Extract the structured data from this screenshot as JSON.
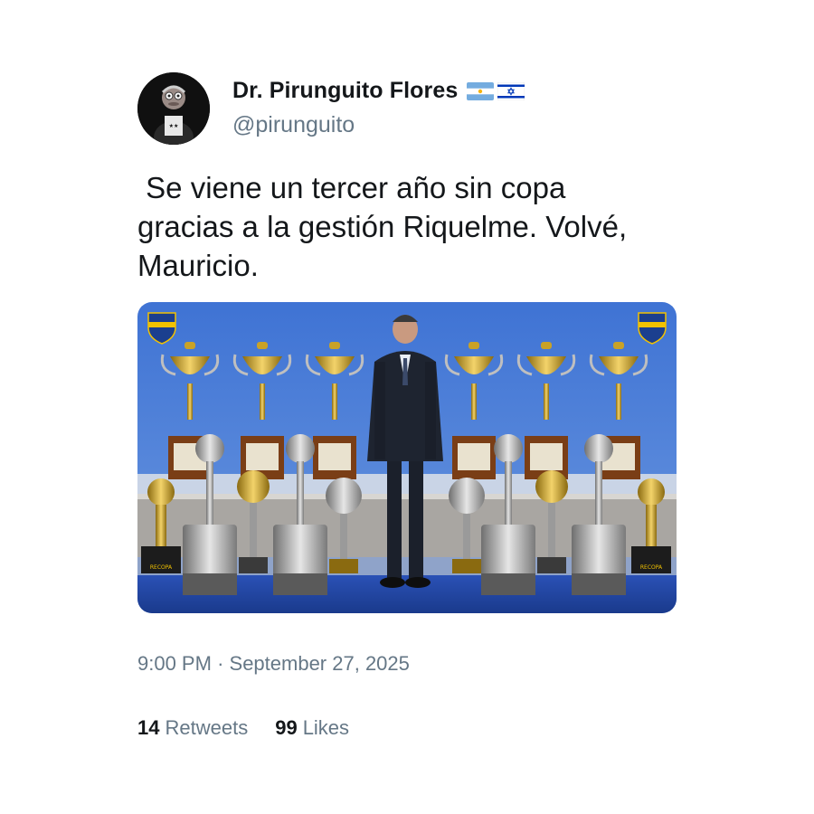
{
  "user": {
    "display_name": "Dr. Pirunguito Flores",
    "handle": "@pirunguito",
    "flags": [
      "argentina-flag-icon",
      "israel-flag-icon"
    ]
  },
  "tweet": {
    "text": " Se viene un tercer año sin copa\ngracias a la gestión Riquelme. Volvé,\nMauricio.",
    "time": "9:00 PM",
    "separator": "·",
    "date": "September 27, 2025"
  },
  "stats": {
    "retweets_count": "14",
    "retweets_label": "Retweets",
    "likes_count": "99",
    "likes_label": "Likes"
  },
  "media": {
    "badge_text": "CABJ",
    "base_label": "RECOPA"
  },
  "colors": {
    "text": "#14171a",
    "muted": "#657786",
    "media_sky": "#3a6fd0",
    "boca_blue": "#1b3f8f",
    "boca_gold": "#f2c200"
  }
}
